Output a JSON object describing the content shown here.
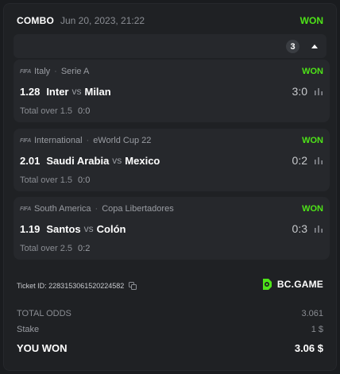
{
  "header": {
    "title": "COMBO",
    "date": "Jun 20, 2023, 21:22",
    "status": "WON"
  },
  "collapse": {
    "count": "3",
    "icon": "chevron-up-icon"
  },
  "bets": [
    {
      "league_logo": "FIFA",
      "region": "Italy",
      "league": "Serie A",
      "status": "WON",
      "odds": "1.28",
      "home": "Inter",
      "vs": "vs",
      "away": "Milan",
      "score": "3:0",
      "pick": "Total over 1.5",
      "pick_value": "0:0"
    },
    {
      "league_logo": "FIFA",
      "region": "International",
      "league": "eWorld Cup 22",
      "status": "WON",
      "odds": "2.01",
      "home": "Saudi Arabia",
      "vs": "vs",
      "away": "Mexico",
      "score": "0:2",
      "pick": "Total over 1.5",
      "pick_value": "0:0"
    },
    {
      "league_logo": "FIFA",
      "region": "South America",
      "league": "Copa Libertadores",
      "status": "WON",
      "odds": "1.19",
      "home": "Santos",
      "vs": "vs",
      "away": "Colón",
      "score": "0:3",
      "pick": "Total over 2.5",
      "pick_value": "0:2"
    }
  ],
  "ticket": {
    "label": "Ticket ID: 2283153061520224582"
  },
  "brand": {
    "name": "BC.GAME",
    "color": "#4ee318"
  },
  "summary": {
    "total_odds_label": "TOTAL ODDS",
    "total_odds": "3.061",
    "stake_label": "Stake",
    "stake": "1 $",
    "won_label": "YOU WON",
    "won": "3.06 $"
  },
  "colors": {
    "won": "#4ee318",
    "card": "#26282c",
    "panel": "#1f2124"
  }
}
